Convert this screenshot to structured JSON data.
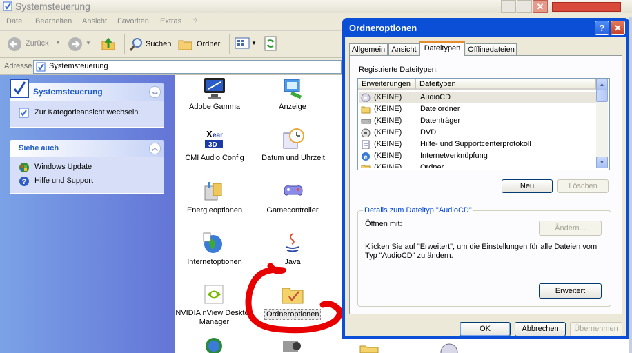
{
  "window": {
    "title": "Systemsteuerung",
    "menu": [
      "Datei",
      "Bearbeiten",
      "Ansicht",
      "Favoriten",
      "Extras",
      "?"
    ],
    "toolbar": {
      "back": "Zurück",
      "search": "Suchen",
      "folders": "Ordner"
    },
    "address_label": "Adresse",
    "address_value": "Systemsteuerung"
  },
  "leftpane": {
    "panel1": {
      "title": "Systemsteuerung",
      "link": "Zur Kategorieansicht wechseln"
    },
    "panel2": {
      "title": "Siehe auch",
      "links": [
        "Windows Update",
        "Hilfe und Support"
      ]
    }
  },
  "icons": [
    {
      "label": "Adobe Gamma",
      "icon": "monitor-icon"
    },
    {
      "label": "Anzeige",
      "icon": "display-icon"
    },
    {
      "label": "CMI Audio Config",
      "icon": "audio-config-icon"
    },
    {
      "label": "Datum und Uhrzeit",
      "icon": "clock-icon"
    },
    {
      "label": "Energieoptionen",
      "icon": "power-icon"
    },
    {
      "label": "Gamecontroller",
      "icon": "gamepad-icon"
    },
    {
      "label": "Internetoptionen",
      "icon": "globe-icon"
    },
    {
      "label": "Java",
      "icon": "java-icon"
    },
    {
      "label": "NVIDIA nView Desktop Manager",
      "icon": "nvidia-icon"
    },
    {
      "label": "Ordneroptionen",
      "icon": "folder-options-icon"
    }
  ],
  "dialog": {
    "title": "Ordneroptionen",
    "tabs": [
      "Allgemein",
      "Ansicht",
      "Dateitypen",
      "Offlinedateien"
    ],
    "selected_tab": "Dateitypen",
    "registered_label": "Registrierte Dateitypen:",
    "columns": [
      "Erweiterungen",
      "Dateitypen"
    ],
    "rows": [
      {
        "ext": "(KEINE)",
        "type": "AudioCD",
        "selected": true
      },
      {
        "ext": "(KEINE)",
        "type": "Dateiordner"
      },
      {
        "ext": "(KEINE)",
        "type": "Datenträger"
      },
      {
        "ext": "(KEINE)",
        "type": "DVD"
      },
      {
        "ext": "(KEINE)",
        "type": "Hilfe- und Supportcenterprotokoll"
      },
      {
        "ext": "(KEINE)",
        "type": "Internetverknüpfung"
      },
      {
        "ext": "(KEINE)",
        "type": "Ordner"
      }
    ],
    "new_btn": "Neu",
    "delete_btn": "Löschen",
    "details_legend": "Details zum Dateityp \"AudioCD\"",
    "opens_with": "Öffnen mit:",
    "change_btn": "Ändern...",
    "info_line1": "Klicken Sie auf \"Erweitert\", um die Einstellungen für alle Dateien vom",
    "info_line2": "Typ \"AudioCD\" zu ändern.",
    "advanced_btn": "Erweitert",
    "ok_btn": "OK",
    "cancel_btn": "Abbrechen",
    "apply_btn": "Übernehmen"
  }
}
